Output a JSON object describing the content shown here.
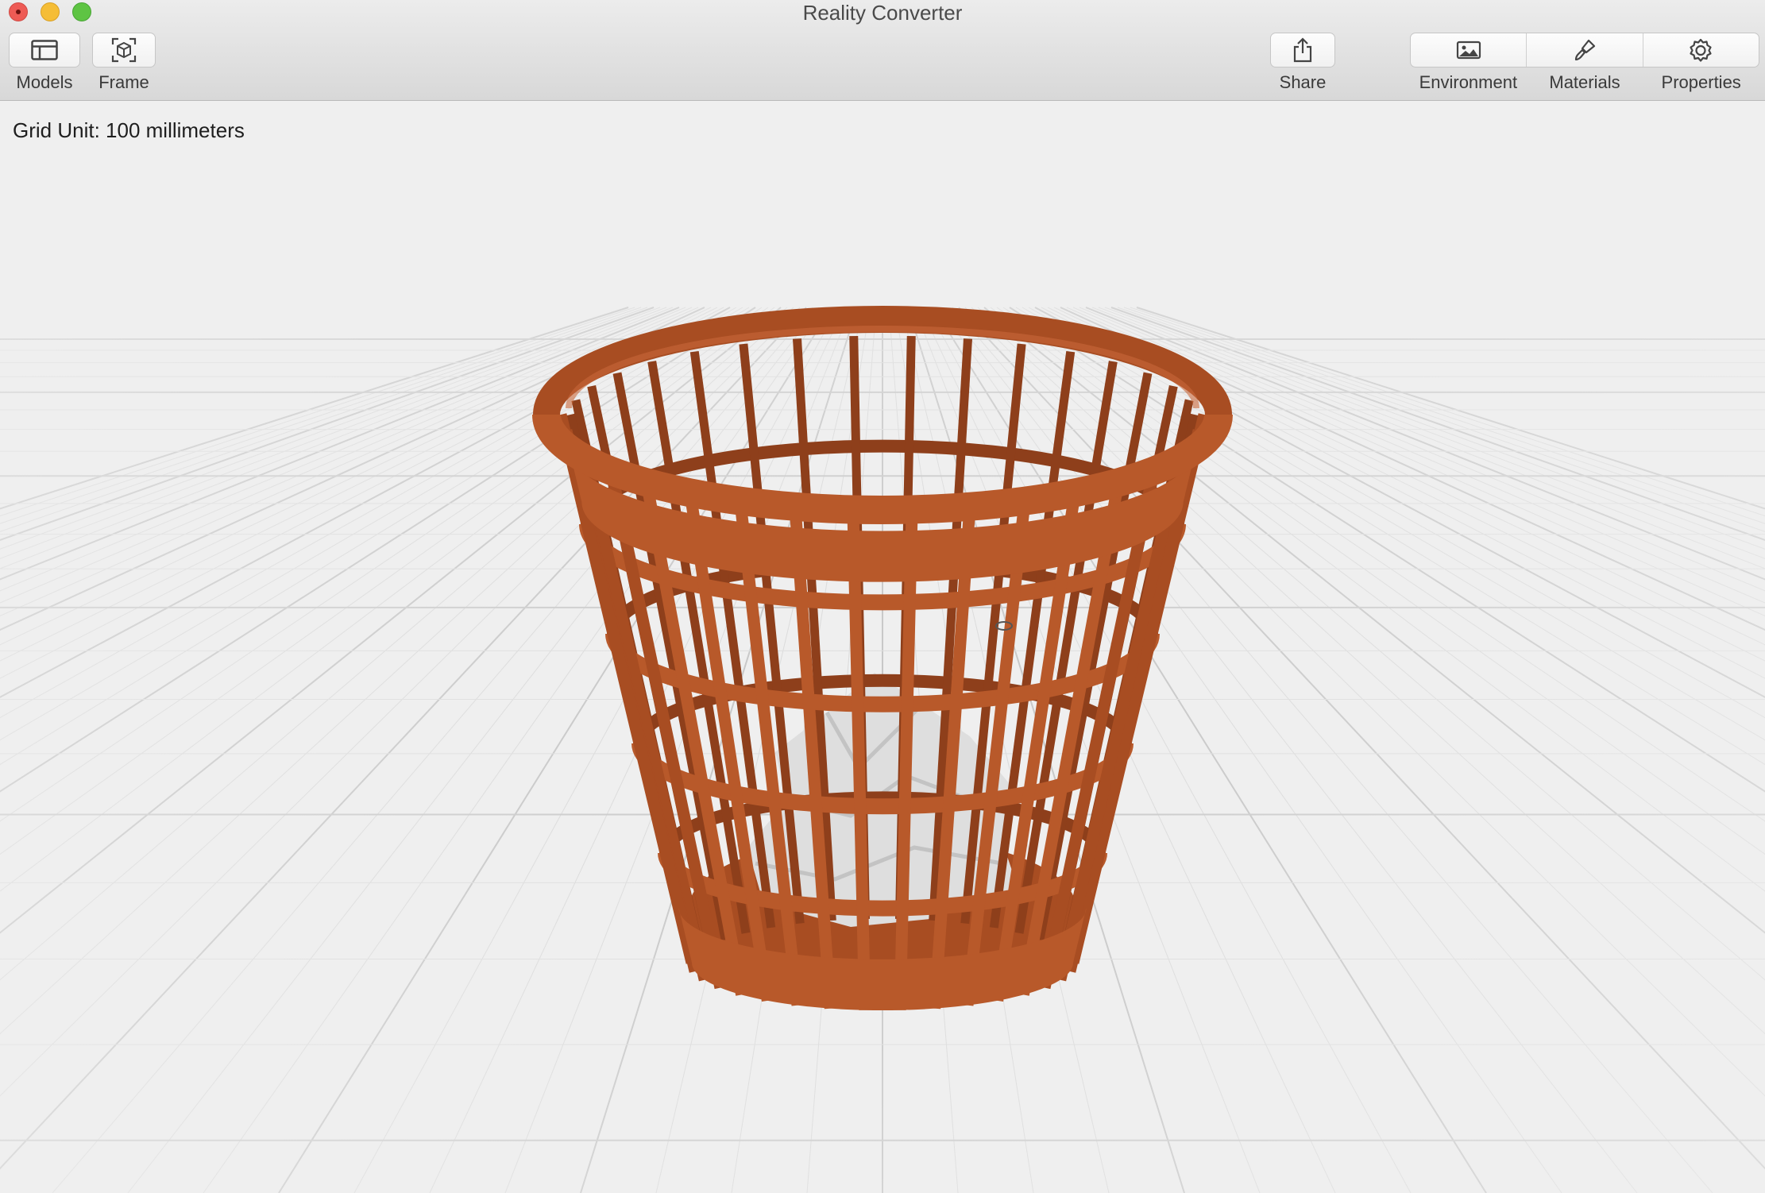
{
  "window": {
    "title": "Reality Converter"
  },
  "toolbar": {
    "models_label": "Models",
    "frame_label": "Frame",
    "share_label": "Share",
    "inspector": [
      {
        "label": "Environment",
        "icon": "photo-icon"
      },
      {
        "label": "Materials",
        "icon": "paintbrush-icon"
      },
      {
        "label": "Properties",
        "icon": "gear-icon"
      }
    ]
  },
  "viewport": {
    "grid_unit_label": "Grid Unit: 100 millimeters",
    "model": "wastebasket",
    "model_color": "#b8592a",
    "paper_color": "#dedede"
  }
}
